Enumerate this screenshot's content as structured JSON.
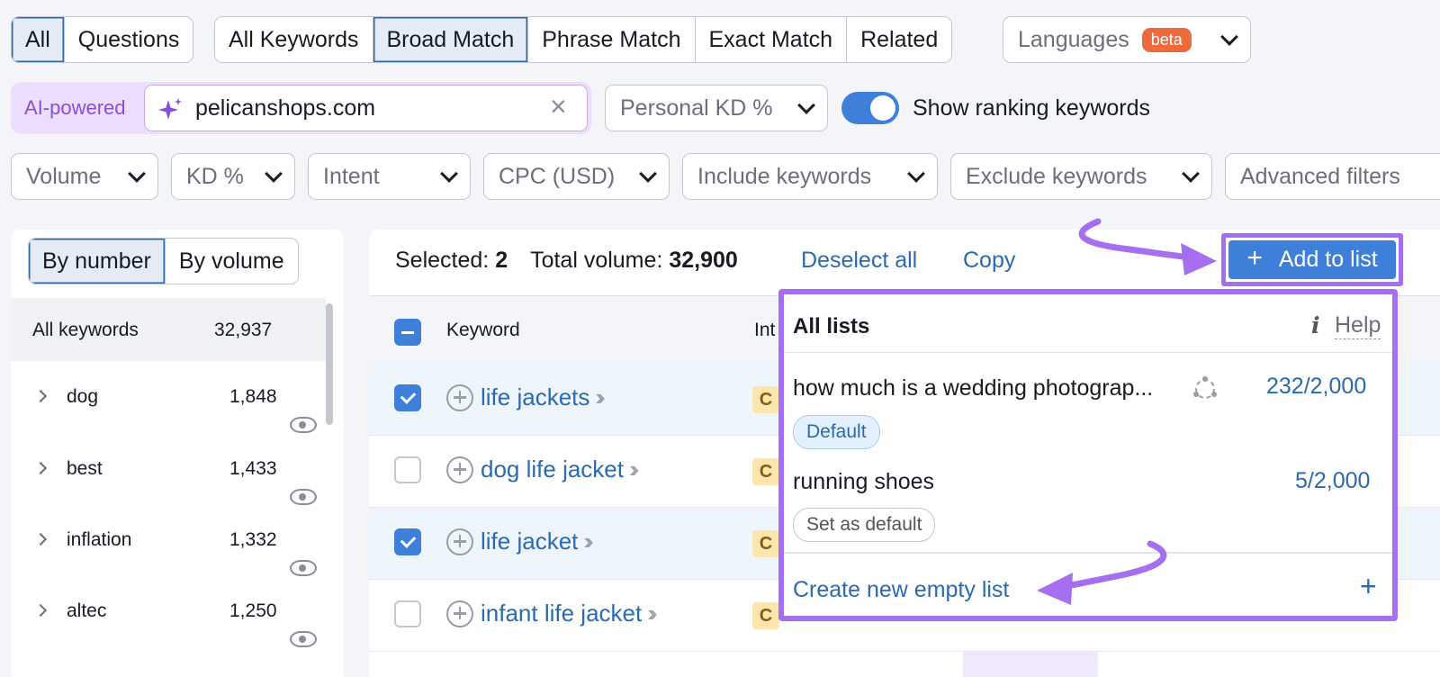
{
  "top_row": {
    "group1": [
      "All",
      "Questions"
    ],
    "group1_active": 0,
    "group2": [
      "All Keywords",
      "Broad Match",
      "Phrase Match",
      "Exact Match",
      "Related"
    ],
    "group2_active": 1,
    "languages_label": "Languages",
    "languages_badge": "beta"
  },
  "search_row": {
    "ai_label": "AI-powered",
    "search_value": "pelicanshops.com",
    "personal_kd": "Personal KD %",
    "toggle_on": true,
    "toggle_label": "Show ranking keywords"
  },
  "filters": [
    "Volume",
    "KD %",
    "Intent",
    "CPC (USD)",
    "Include keywords",
    "Exclude keywords",
    "Advanced filters"
  ],
  "left_panel": {
    "tabs": [
      "By number",
      "By volume"
    ],
    "active_tab": 0,
    "all_label": "All keywords",
    "all_count": "32,937",
    "groups": [
      {
        "label": "dog",
        "count": "1,848"
      },
      {
        "label": "best",
        "count": "1,433"
      },
      {
        "label": "inflation",
        "count": "1,332"
      },
      {
        "label": "altec",
        "count": "1,250"
      }
    ]
  },
  "main": {
    "selected_label": "Selected:",
    "selected_count": "2",
    "total_label": "Total volume:",
    "total_value": "32,900",
    "deselect": "Deselect all",
    "copy": "Copy",
    "add_to_list": "Add to list",
    "col_keyword": "Keyword",
    "col_intent": "Int",
    "rows": [
      {
        "keyword": "life jackets",
        "checked": true,
        "intent": "C"
      },
      {
        "keyword": "dog life jacket",
        "checked": false,
        "intent": "C"
      },
      {
        "keyword": "life jacket",
        "checked": true,
        "intent": "C"
      },
      {
        "keyword": "infant life jacket",
        "checked": false,
        "intent": "C"
      }
    ]
  },
  "popup": {
    "title": "All lists",
    "help": "Help",
    "lists": [
      {
        "name": "how much is a wedding photograp...",
        "count": "232/2,000",
        "tag": "Default"
      },
      {
        "name": "running shoes",
        "count": "5/2,000",
        "tag": "Set as default"
      }
    ],
    "create": "Create new empty list",
    "create_plus": "+"
  },
  "colors": {
    "accent": "#3d7fd9",
    "link": "#2a6ab0",
    "highlight": "#a66ef1"
  }
}
